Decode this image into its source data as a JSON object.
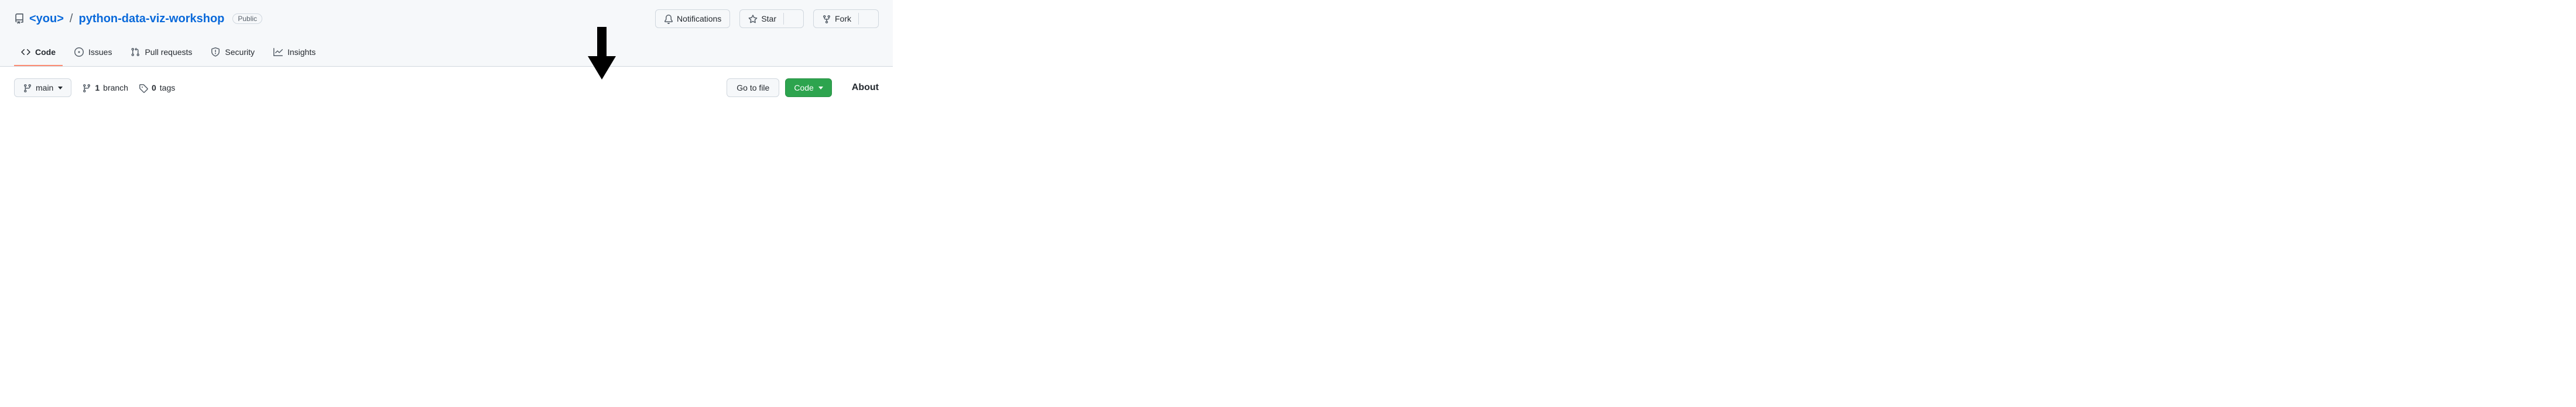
{
  "repo": {
    "owner": "<you>",
    "slash": "/",
    "name": "python-data-viz-workshop",
    "visibility": "Public"
  },
  "actions": {
    "notifications": "Notifications",
    "star": "Star",
    "fork": "Fork"
  },
  "tabs": {
    "code": "Code",
    "issues": "Issues",
    "pull_requests": "Pull requests",
    "security": "Security",
    "insights": "Insights"
  },
  "toolbar": {
    "branch": "main",
    "branch_count": "1",
    "branch_label": "branch",
    "tags_count": "0",
    "tags_label": "tags",
    "go_to_file": "Go to file",
    "code_button": "Code"
  },
  "sidebar": {
    "about_heading": "About"
  }
}
